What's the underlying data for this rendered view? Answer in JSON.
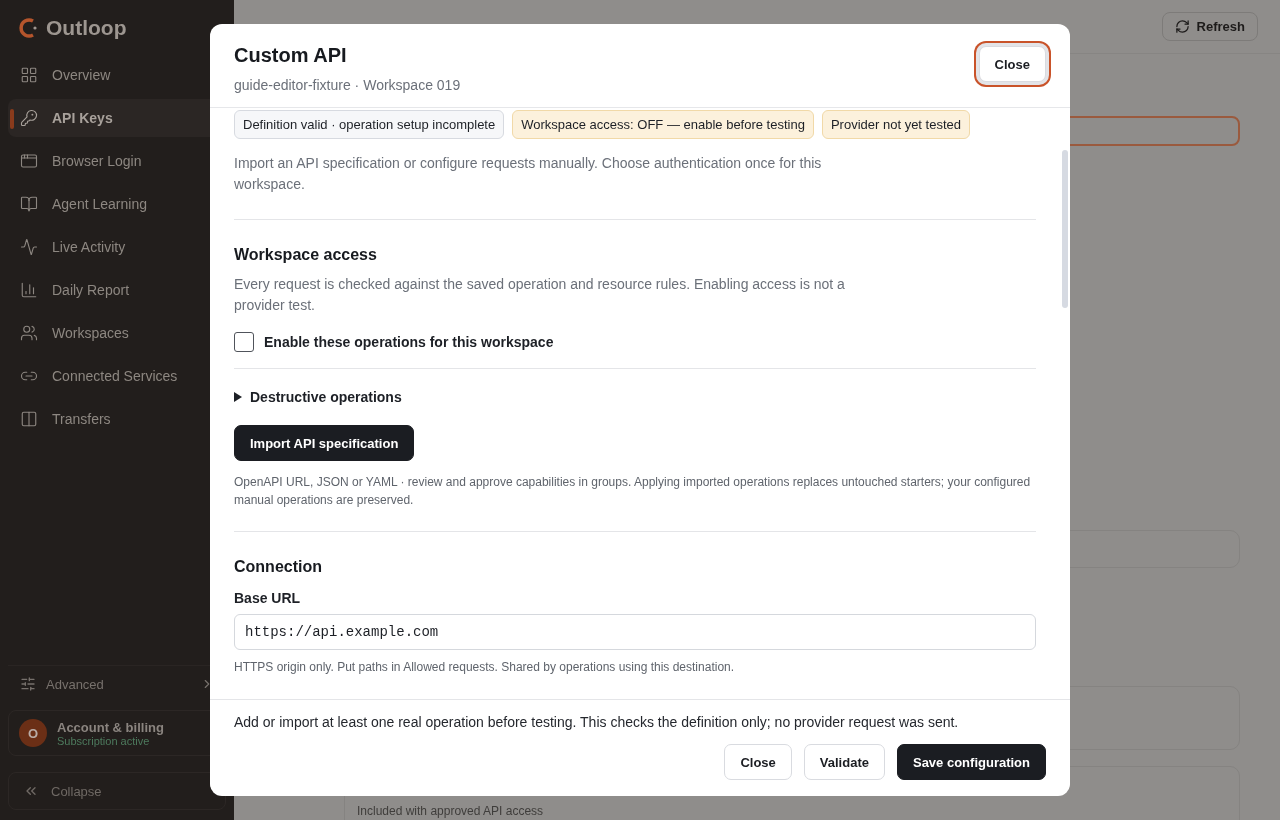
{
  "sidebar": {
    "brand": "Outloop",
    "items": [
      {
        "label": "Overview",
        "selected": false
      },
      {
        "label": "API Keys",
        "selected": true
      },
      {
        "label": "Browser Login",
        "selected": false
      },
      {
        "label": "Agent Learning",
        "selected": false
      },
      {
        "label": "Live Activity",
        "selected": false
      },
      {
        "label": "Daily Report",
        "selected": false
      },
      {
        "label": "Workspaces",
        "selected": false
      },
      {
        "label": "Connected Services",
        "selected": false
      },
      {
        "label": "Transfers",
        "selected": false
      }
    ],
    "advanced": "Advanced",
    "account": {
      "initial": "O",
      "name": "Account & billing",
      "status": "Subscription active"
    },
    "collapse": "Collapse"
  },
  "header": {
    "refresh": "Refresh"
  },
  "background_note": "Included with approved API access",
  "modal": {
    "title": "Custom API",
    "subtitle": "guide-editor-fixture · Workspace 019",
    "close": "Close",
    "badges": [
      {
        "label": "Definition valid · operation setup incomplete",
        "kind": "neutral"
      },
      {
        "label": "Workspace access: OFF — enable before testing",
        "kind": "warning"
      },
      {
        "label": "Provider not yet tested",
        "kind": "warning"
      }
    ],
    "intro": "Import an API specification or configure requests manually. Choose authentication once for this workspace.",
    "access": {
      "heading": "Workspace access",
      "text": "Every request is checked against the saved operation and resource rules. Enabling access is not a provider test.",
      "checkbox": {
        "label": "Enable these operations for this workspace",
        "checked": false
      }
    },
    "destructive": {
      "label": "Destructive operations",
      "expanded": false
    },
    "import": {
      "button": "Import API specification",
      "hint": "OpenAPI URL, JSON or YAML · review and approve capabilities in groups. Applying imported operations replaces untouched starters; your configured manual operations are preserved."
    },
    "connection": {
      "heading": "Connection",
      "field_label": "Base URL",
      "value": "https://api.example.com",
      "hint": "HTTPS origin only. Put paths in Allowed requests. Shared by operations using this destination."
    },
    "footer": {
      "note": "Add or import at least one real operation before testing. This checks the definition only; no provider request was sent.",
      "buttons": [
        {
          "label": "Close",
          "kind": "secondary"
        },
        {
          "label": "Validate",
          "kind": "secondary"
        },
        {
          "label": "Save configuration",
          "kind": "primary"
        }
      ]
    }
  }
}
